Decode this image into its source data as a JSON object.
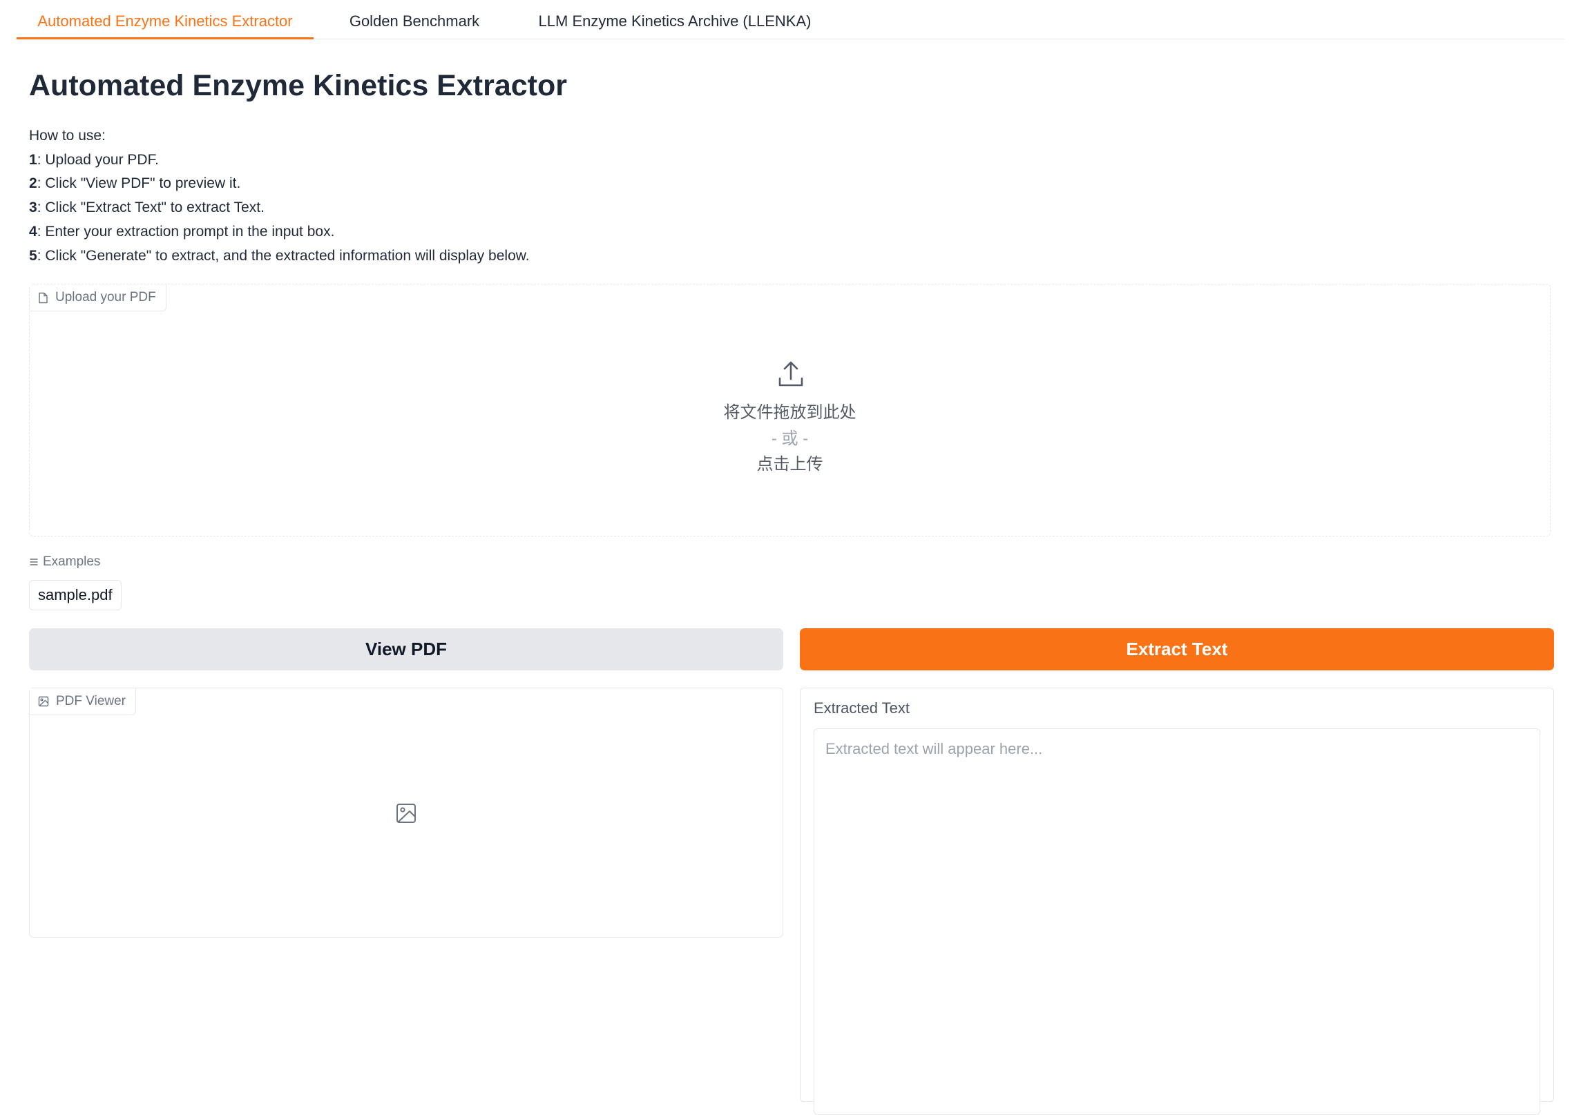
{
  "tabs": [
    {
      "label": "Automated Enzyme Kinetics Extractor",
      "active": true
    },
    {
      "label": "Golden Benchmark",
      "active": false
    },
    {
      "label": "LLM Enzyme Kinetics Archive (LLENKA)",
      "active": false
    }
  ],
  "page_title": "Automated Enzyme Kinetics Extractor",
  "instructions": {
    "intro": "How to use:",
    "steps": [
      {
        "num": "1",
        "text": ": Upload your PDF."
      },
      {
        "num": "2",
        "text": ": Click \"View PDF\" to preview it."
      },
      {
        "num": "3",
        "text": ": Click \"Extract Text\" to extract Text."
      },
      {
        "num": "4",
        "text": ": Enter your extraction prompt in the input box."
      },
      {
        "num": "5",
        "text": ": Click \"Generate\" to extract, and the extracted information will display below."
      }
    ]
  },
  "upload": {
    "label": "Upload your PDF",
    "drop_text": "将文件拖放到此处",
    "or_text": "- 或 -",
    "click_text": "点击上传",
    "icon": "upload-icon"
  },
  "examples": {
    "label": "Examples",
    "items": [
      "sample.pdf"
    ]
  },
  "buttons": {
    "view_pdf": "View PDF",
    "extract_text": "Extract Text"
  },
  "pdf_viewer": {
    "label": "PDF Viewer"
  },
  "extracted": {
    "label": "Extracted Text",
    "placeholder": "Extracted text will appear here...",
    "value": ""
  },
  "colors": {
    "accent": "#f97316",
    "secondary_button": "#e5e7eb",
    "border": "#e5e7eb",
    "muted_text": "#6b7280"
  }
}
